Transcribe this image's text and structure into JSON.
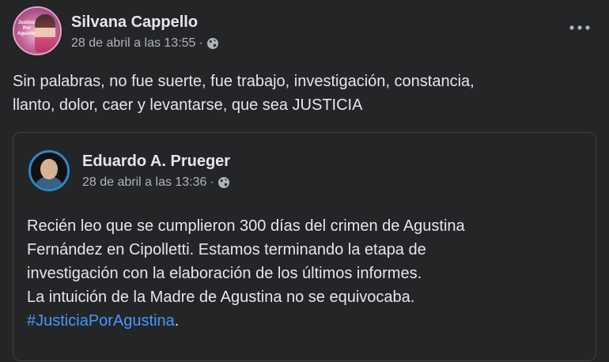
{
  "post": {
    "author": "Silvana Cappello",
    "avatar_text": "Justicia Por Agustina",
    "timestamp": "28 de abril a las 13:55",
    "separator": "·",
    "privacy_icon": "globe-icon",
    "more_icon": "more-options-icon",
    "text_lines": [
      "Sin palabras, no fue suerte, fue trabajo, investigación, constancia,",
      "llanto, dolor, caer y levantarse, que sea JUSTICIA"
    ]
  },
  "shared_post": {
    "author": "Eduardo A. Prueger",
    "timestamp": "28 de abril a las 13:36",
    "separator": "·",
    "privacy_icon": "globe-icon",
    "text_lines": [
      "Recién leo que se cumplieron 300 días del crimen de Agustina",
      "Fernández en Cipolletti. Estamos terminando la etapa de",
      "investigación con la elaboración de los últimos informes.",
      "La intuición de la Madre de Agustina no se equivocaba."
    ],
    "hashtag": "#JusticiaPorAgustina",
    "hashtag_suffix": "."
  },
  "colors": {
    "background": "#242526",
    "text_primary": "#e4e6eb",
    "text_secondary": "#b0b3b8",
    "link": "#4599ff",
    "border": "#3e4042"
  }
}
